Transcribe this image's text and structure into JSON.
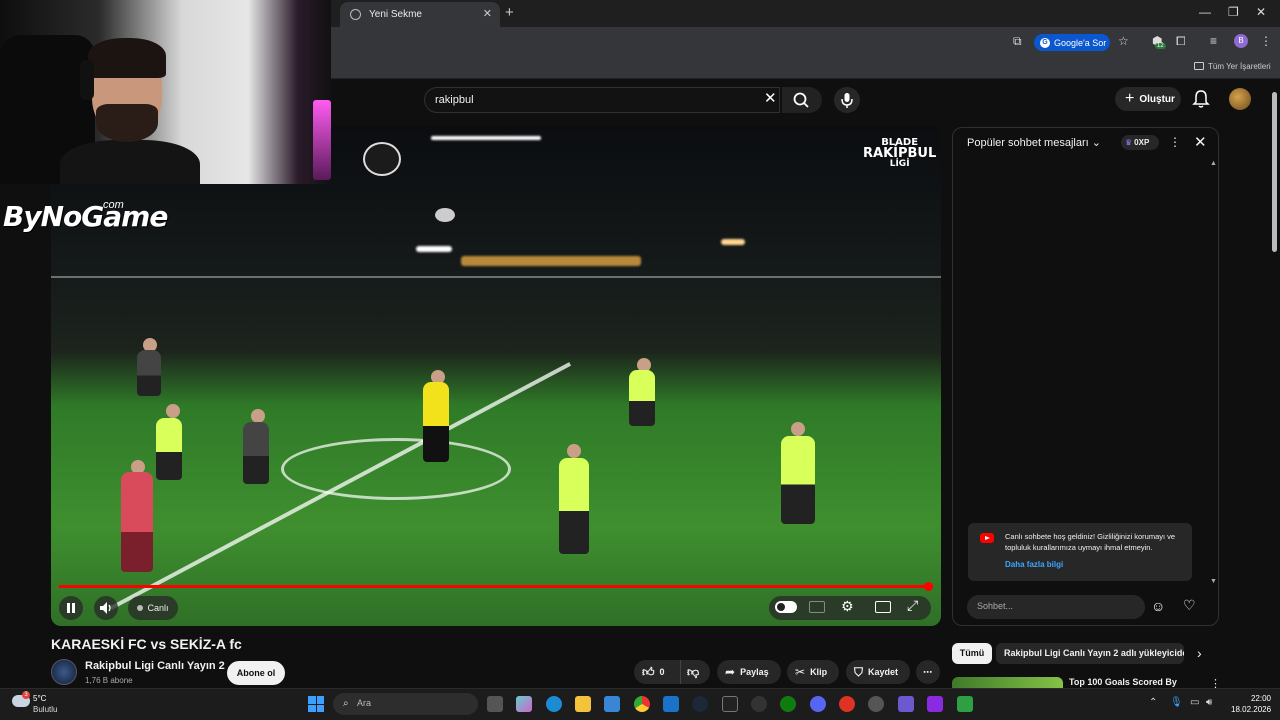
{
  "browser": {
    "tab_title": "Yeni Sekme",
    "new_tab_symbol": "+",
    "close_symbol": "✕",
    "minimize": "—",
    "maximize": "❐",
    "close_window": "✕",
    "google_button": "Google'a Sor",
    "profile_initial": "B",
    "extension_badge": "12",
    "bookmarks_label": "Tüm Yer İşaretleri"
  },
  "youtube_header": {
    "search_value": "rakipbul",
    "create_label": "Oluştur"
  },
  "video": {
    "overlay_brand": "BLADE",
    "overlay_league": "RAKİPBUL",
    "overlay_league_sub": "LİGİ",
    "live_label": "Canlı",
    "progress_fraction": 1.0
  },
  "streamer_overlay": {
    "brand": "ByNoGame",
    "brand_suffix": ".com"
  },
  "video_info": {
    "title": "KARAESKİ FC vs SEKİZ-A fc",
    "channel_name": "Rakipbul Ligi Canlı Yayın 2",
    "subscribers": "1,76 B abone",
    "subscribe_label": "Abone ol",
    "like_count": "0",
    "share_label": "Paylaş",
    "clip_label": "Klip",
    "save_label": "Kaydet"
  },
  "chat": {
    "header_label": "Popüler sohbet mesajları",
    "xp_label": "0XP",
    "welcome_text": "Canlı sohbete hoş geldiniz! Gizliliğinizi korumayı ve topluluk kurallarımıza uymayı ihmal etmeyin.",
    "welcome_link": "Daha fazla bilgi",
    "input_placeholder": "Sohbet..."
  },
  "recommendations": {
    "chip_all": "Tümü",
    "chip_uploader": "Rakipbul Ligi Canlı Yayın 2 adlı yükleyiciden",
    "first_title": "Top 100 Goals Scored By"
  },
  "taskbar": {
    "temperature": "5°C",
    "condition": "Bulutlu",
    "weather_badge": "3",
    "search_placeholder": "Ara",
    "time": "22:00",
    "date": "18.02.2026"
  },
  "colors": {
    "accent_red": "#ff0000",
    "link_blue": "#3ea6ff",
    "google_blue": "#0b57d0"
  }
}
